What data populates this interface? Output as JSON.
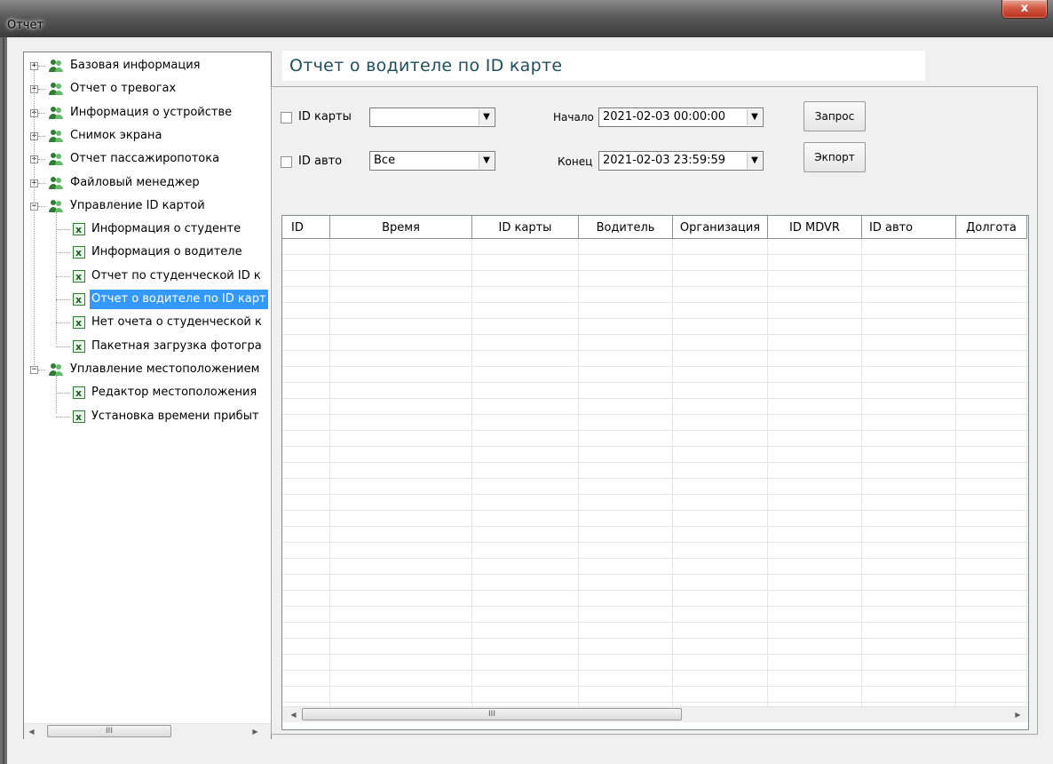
{
  "window": {
    "title": "Отчет",
    "close_label": "x"
  },
  "tree": {
    "items": [
      {
        "label": "Базовая информация",
        "type": "group",
        "expander": "+"
      },
      {
        "label": "Отчет о тревогах",
        "type": "group",
        "expander": "+"
      },
      {
        "label": "Информация о устройстве",
        "type": "group",
        "expander": "+"
      },
      {
        "label": "Снимок экрана",
        "type": "group",
        "expander": "+"
      },
      {
        "label": "Отчет пассажиропотока",
        "type": "group",
        "expander": "+"
      },
      {
        "label": "Файловый менеджер",
        "type": "group",
        "expander": "+"
      },
      {
        "label": "Управление ID картой",
        "type": "group",
        "expander": "−"
      },
      {
        "label": "Информация о студенте",
        "type": "leaf"
      },
      {
        "label": "Информация о водителе",
        "type": "leaf"
      },
      {
        "label": "Отчет по студенческой ID к",
        "type": "leaf"
      },
      {
        "label": "Отчет о водителе по ID карт",
        "type": "leaf",
        "selected": true
      },
      {
        "label": "Нет очета о студенческой к",
        "type": "leaf"
      },
      {
        "label": "Пакетная загрузка фотогра",
        "type": "leaf"
      },
      {
        "label": "Уплавление местоположением",
        "type": "group",
        "expander": "−"
      },
      {
        "label": "Редактор местоположения",
        "type": "leaf"
      },
      {
        "label": "Установка времени прибыт",
        "type": "leaf"
      }
    ],
    "scroll_thumb_label": "III"
  },
  "report": {
    "title": "Отчет о водителе по ID карте",
    "card_id_label": "ID карты",
    "card_id_value": "",
    "auto_id_label": "ID авто",
    "auto_id_value": "Все",
    "start_label": "Начало",
    "start_value": "2021-02-03 00:00:00",
    "end_label": "Конец",
    "end_value": "2021-02-03 23:59:59",
    "query_button": "Запрос",
    "export_button": "Экпорт"
  },
  "table": {
    "columns": [
      "ID",
      "Время",
      "ID карты",
      "Водитель",
      "Организация",
      "ID MDVR",
      "ID авто",
      "Долгота"
    ],
    "rows": [],
    "scroll_thumb_label": "III"
  },
  "icons": {
    "people": "people-icon",
    "sheet": "sheet-icon",
    "dropdown": "chevron-down-icon"
  },
  "colors": {
    "selection": "#3399ff",
    "title_text": "#1f4e5a",
    "close_button": "#c7432f"
  }
}
